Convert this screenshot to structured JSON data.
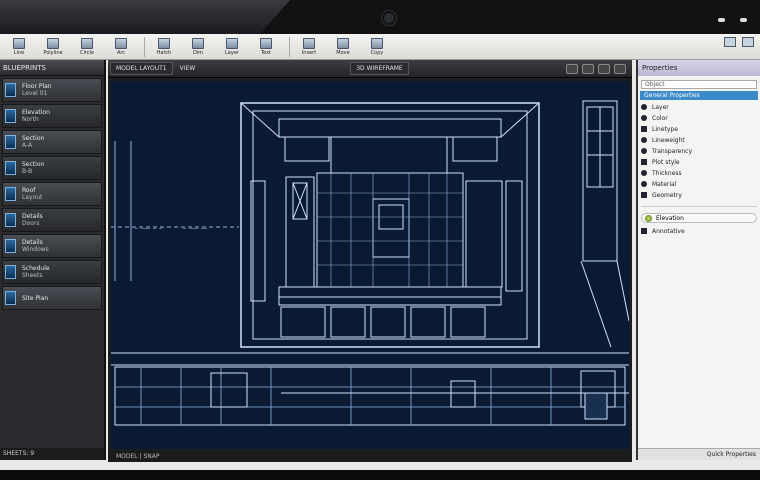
{
  "window": {
    "title": ""
  },
  "ribbon": {
    "buttons": [
      {
        "label": "Line",
        "icon": "line-tool-icon"
      },
      {
        "label": "Polyline",
        "icon": "polyline-icon"
      },
      {
        "label": "Circle",
        "icon": "circle-tool-icon"
      },
      {
        "label": "Arc",
        "icon": "arc-tool-icon"
      },
      {
        "label": "Hatch",
        "icon": "hatch-icon"
      },
      {
        "label": "Dim",
        "icon": "dimension-icon"
      },
      {
        "label": "Layer",
        "icon": "layers-icon"
      },
      {
        "label": "Text",
        "icon": "text-tool-icon"
      },
      {
        "label": "Insert",
        "icon": "insert-block-icon"
      },
      {
        "label": "Move",
        "icon": "move-icon"
      },
      {
        "label": "Copy",
        "icon": "copy-icon"
      }
    ]
  },
  "left_panel": {
    "title": "BLUEPRINTS",
    "items": [
      {
        "title": "Floor Plan",
        "sub": "Level 01"
      },
      {
        "title": "Elevation",
        "sub": "North"
      },
      {
        "title": "Section",
        "sub": "A-A"
      },
      {
        "title": "Section",
        "sub": "B-B"
      },
      {
        "title": "Roof",
        "sub": "Layout"
      },
      {
        "title": "Details",
        "sub": "Doors"
      },
      {
        "title": "Details",
        "sub": "Windows"
      },
      {
        "title": "Schedule",
        "sub": "Sheets"
      },
      {
        "title": "Site Plan",
        "sub": ""
      }
    ],
    "footer": "SHEETS: 9"
  },
  "viewport": {
    "tabs": [
      "MODEL  LAYOUT1",
      "VIEW"
    ],
    "mode": "3D  WIREFRAME",
    "status": "MODEL  |  SNAP"
  },
  "right_panel": {
    "title": "Properties",
    "search": "Object",
    "selected": "General Properties",
    "items": [
      "Layer",
      "Color",
      "Linetype",
      "Lineweight",
      "Transparency",
      "Plot style",
      "Thickness",
      "Material",
      "Geometry"
    ],
    "swatch": "Elevation",
    "swatch2": "Annotative",
    "footer": "Quick Properties"
  },
  "colors": {
    "blueprint_bg": "#0b1a33",
    "line": "#cfe3ff",
    "accent": "#3b8bc9"
  }
}
